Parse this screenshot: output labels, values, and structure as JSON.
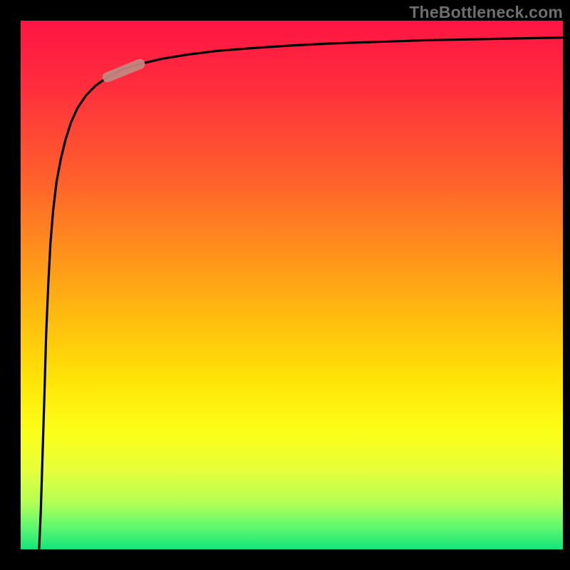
{
  "watermark": "TheBottleneck.com",
  "colors": {
    "background": "#000000",
    "curve": "#000000",
    "highlight": "#c48a82"
  },
  "chart_data": {
    "type": "line",
    "title": "",
    "xlabel": "",
    "ylabel": "",
    "xlim": [
      0,
      100
    ],
    "ylim": [
      0,
      100
    ],
    "grid": false,
    "annotations": [
      {
        "text": "TheBottleneck.com",
        "position": "top-right"
      }
    ],
    "series": [
      {
        "name": "curve",
        "x": [
          3.4,
          3.7,
          4.0,
          4.4,
          4.7,
          5.1,
          5.5,
          6.0,
          6.6,
          7.4,
          8.3,
          9.3,
          10.5,
          12.0,
          13.8,
          16.0,
          18.7,
          22.0,
          26.1,
          30.9,
          36.4,
          42.7,
          49.8,
          57.6,
          66.0,
          75.0,
          84.4,
          94.3,
          100.0
        ],
        "y": [
          0.0,
          6.9,
          16.6,
          29.9,
          40.7,
          50.3,
          58.0,
          64.2,
          69.4,
          73.8,
          77.6,
          80.8,
          83.5,
          85.8,
          87.7,
          89.3,
          90.7,
          91.8,
          92.8,
          93.6,
          94.3,
          94.8,
          95.3,
          95.7,
          96.0,
          96.3,
          96.5,
          96.7,
          96.8
        ]
      }
    ],
    "highlight_segment": {
      "x_start": 16.0,
      "x_end": 22.0,
      "description": "emphasized pill-shaped segment on the curve"
    }
  }
}
